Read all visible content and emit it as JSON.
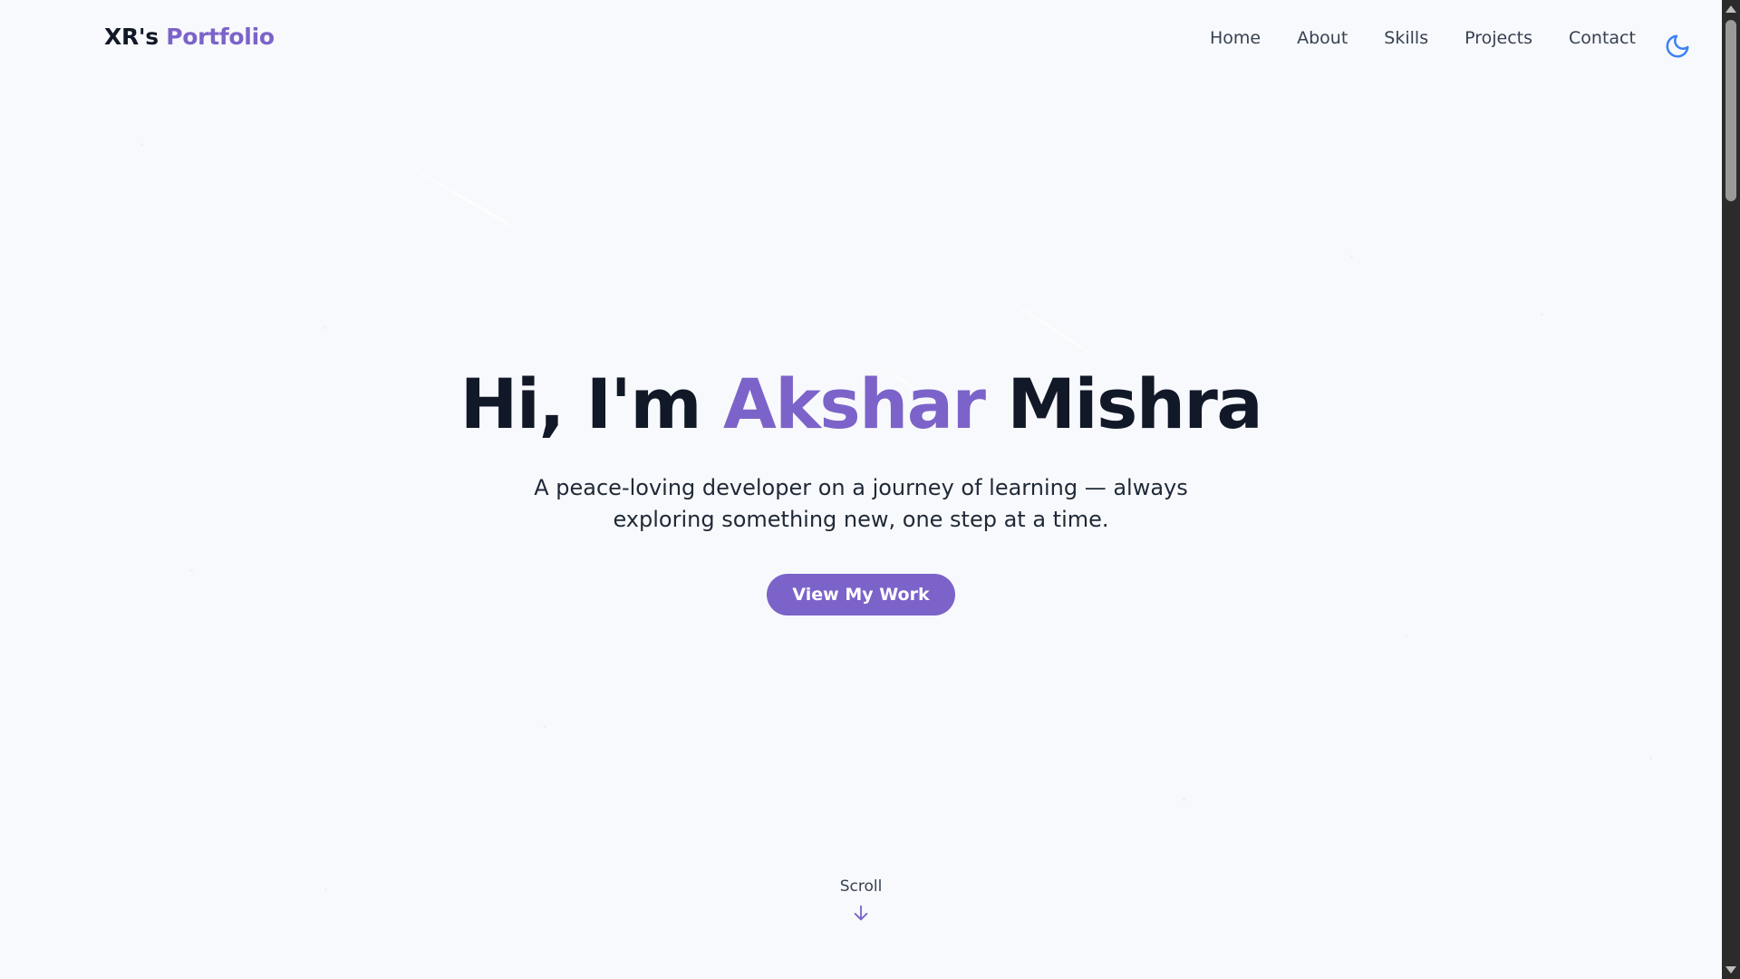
{
  "nav": {
    "brand_prefix": "XR's ",
    "brand_accent": "Portfolio",
    "links": [
      {
        "label": "Home"
      },
      {
        "label": "About"
      },
      {
        "label": "Skills"
      },
      {
        "label": "Projects"
      },
      {
        "label": "Contact"
      }
    ],
    "theme_toggle_icon": "moon-icon"
  },
  "hero": {
    "greeting": "Hi, I'm ",
    "first_name": "Akshar",
    "last_name": " Mishra",
    "subtitle": "A peace-loving developer on a journey of learning — always exploring something new, one step at a time.",
    "cta_label": "View My Work"
  },
  "scroll_hint": {
    "label": "Scroll",
    "icon": "arrow-down-icon"
  },
  "colors": {
    "accent": "#7c63c9",
    "text": "#111827",
    "background": "#f8f9fc",
    "toggle": "#3b82f6"
  }
}
